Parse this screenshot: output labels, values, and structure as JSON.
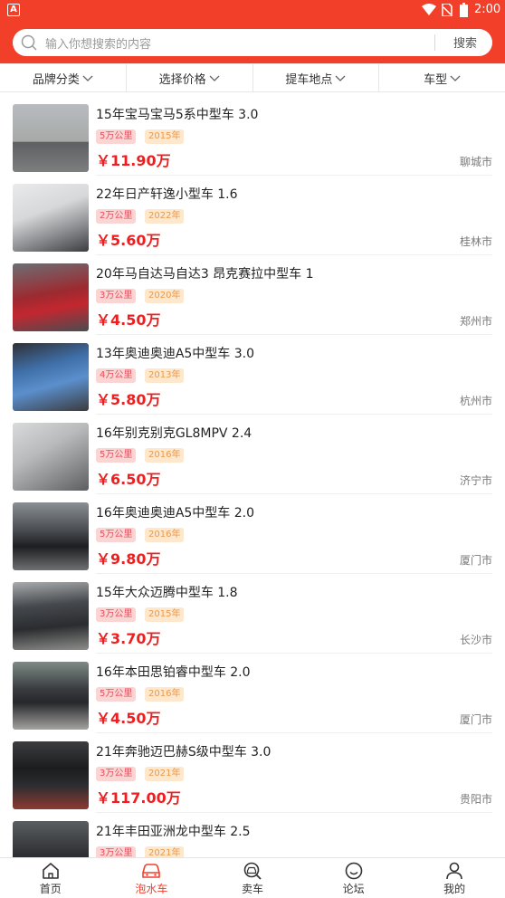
{
  "status_bar": {
    "left_icon": "A",
    "time": "2:00"
  },
  "search": {
    "placeholder": "输入你想搜索的内容",
    "button": "搜索"
  },
  "filters": [
    {
      "label": "品牌分类"
    },
    {
      "label": "选择价格"
    },
    {
      "label": "提车地点"
    },
    {
      "label": "车型"
    }
  ],
  "listings": [
    {
      "title": "15年宝马宝马5系中型车 3.0",
      "mileage": "5万公里",
      "year": "2015年",
      "price": "￥11.90万",
      "city": "聊城市"
    },
    {
      "title": "22年日产轩逸小型车 1.6",
      "mileage": "2万公里",
      "year": "2022年",
      "price": "￥5.60万",
      "city": "桂林市"
    },
    {
      "title": "20年马自达马自达3 昂克赛拉中型车 1",
      "mileage": "3万公里",
      "year": "2020年",
      "price": "￥4.50万",
      "city": "郑州市"
    },
    {
      "title": "13年奥迪奥迪A5中型车 3.0",
      "mileage": "4万公里",
      "year": "2013年",
      "price": "￥5.80万",
      "city": "杭州市"
    },
    {
      "title": "16年别克别克GL8MPV 2.4",
      "mileage": "5万公里",
      "year": "2016年",
      "price": "￥6.50万",
      "city": "济宁市"
    },
    {
      "title": "16年奥迪奥迪A5中型车 2.0",
      "mileage": "5万公里",
      "year": "2016年",
      "price": "￥9.80万",
      "city": "厦门市"
    },
    {
      "title": "15年大众迈腾中型车 1.8",
      "mileage": "3万公里",
      "year": "2015年",
      "price": "￥3.70万",
      "city": "长沙市"
    },
    {
      "title": "16年本田思铂睿中型车 2.0",
      "mileage": "5万公里",
      "year": "2016年",
      "price": "￥4.50万",
      "city": "厦门市"
    },
    {
      "title": "21年奔驰迈巴赫S级中型车 3.0",
      "mileage": "3万公里",
      "year": "2021年",
      "price": "￥117.00万",
      "city": "贵阳市"
    },
    {
      "title": "21年丰田亚洲龙中型车 2.5",
      "mileage": "3万公里",
      "year": "2021年",
      "price": "",
      "city": ""
    }
  ],
  "tabs": [
    {
      "label": "首页",
      "icon": "home-icon"
    },
    {
      "label": "泡水车",
      "icon": "car-icon"
    },
    {
      "label": "卖车",
      "icon": "car-search-icon"
    },
    {
      "label": "论坛",
      "icon": "smile-icon"
    },
    {
      "label": "我的",
      "icon": "user-icon"
    }
  ],
  "colors": {
    "brand": "#f23f2a",
    "price": "#f01e1e",
    "mileage_tag_bg": "#fbd4d4",
    "year_tag_bg": "#fde7cd"
  }
}
